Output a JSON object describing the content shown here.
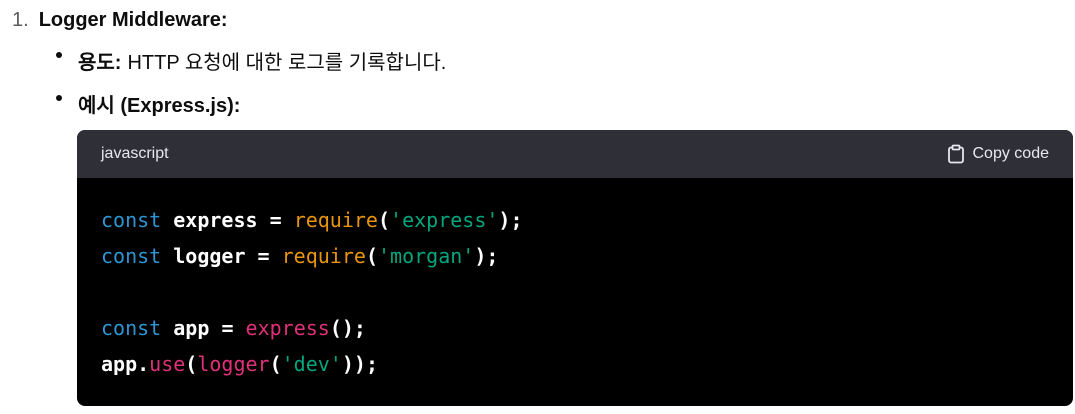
{
  "list": {
    "number": "1.",
    "title": "Logger Middleware:"
  },
  "bullets": [
    {
      "strong": "용도:",
      "text": "HTTP 요청에 대한 로그를 기록합니다."
    },
    {
      "strong": "예시 (Express.js):",
      "text": ""
    }
  ],
  "code_block": {
    "language": "javascript",
    "copy_label": "Copy code",
    "lines": [
      [
        {
          "t": "const",
          "c": "kw"
        },
        {
          "t": " express ",
          "c": "plain"
        },
        {
          "t": "=",
          "c": "punc"
        },
        {
          "t": " ",
          "c": "plain"
        },
        {
          "t": "require",
          "c": "fn-req"
        },
        {
          "t": "(",
          "c": "punc"
        },
        {
          "t": "'express'",
          "c": "str"
        },
        {
          "t": ");",
          "c": "punc"
        }
      ],
      [
        {
          "t": "const",
          "c": "kw"
        },
        {
          "t": " logger ",
          "c": "plain"
        },
        {
          "t": "=",
          "c": "punc"
        },
        {
          "t": " ",
          "c": "plain"
        },
        {
          "t": "require",
          "c": "fn-req"
        },
        {
          "t": "(",
          "c": "punc"
        },
        {
          "t": "'morgan'",
          "c": "str"
        },
        {
          "t": ");",
          "c": "punc"
        }
      ],
      [],
      [
        {
          "t": "const",
          "c": "kw"
        },
        {
          "t": " app ",
          "c": "plain"
        },
        {
          "t": "=",
          "c": "punc"
        },
        {
          "t": " ",
          "c": "plain"
        },
        {
          "t": "express",
          "c": "fn-red"
        },
        {
          "t": "();",
          "c": "punc"
        }
      ],
      [
        {
          "t": "app",
          "c": "plain"
        },
        {
          "t": ".",
          "c": "punc"
        },
        {
          "t": "use",
          "c": "fn-red"
        },
        {
          "t": "(",
          "c": "punc"
        },
        {
          "t": "logger",
          "c": "fn-red"
        },
        {
          "t": "(",
          "c": "punc"
        },
        {
          "t": "'dev'",
          "c": "str"
        },
        {
          "t": "));",
          "c": "punc"
        }
      ]
    ]
  },
  "colors": {
    "keyword": "#2e95d3",
    "require": "#e9950c",
    "function": "#df3079",
    "string": "#00a67d",
    "code_bg": "#000000",
    "header_bg": "#2f2f37"
  },
  "icons": {
    "copy": "clipboard-icon"
  }
}
